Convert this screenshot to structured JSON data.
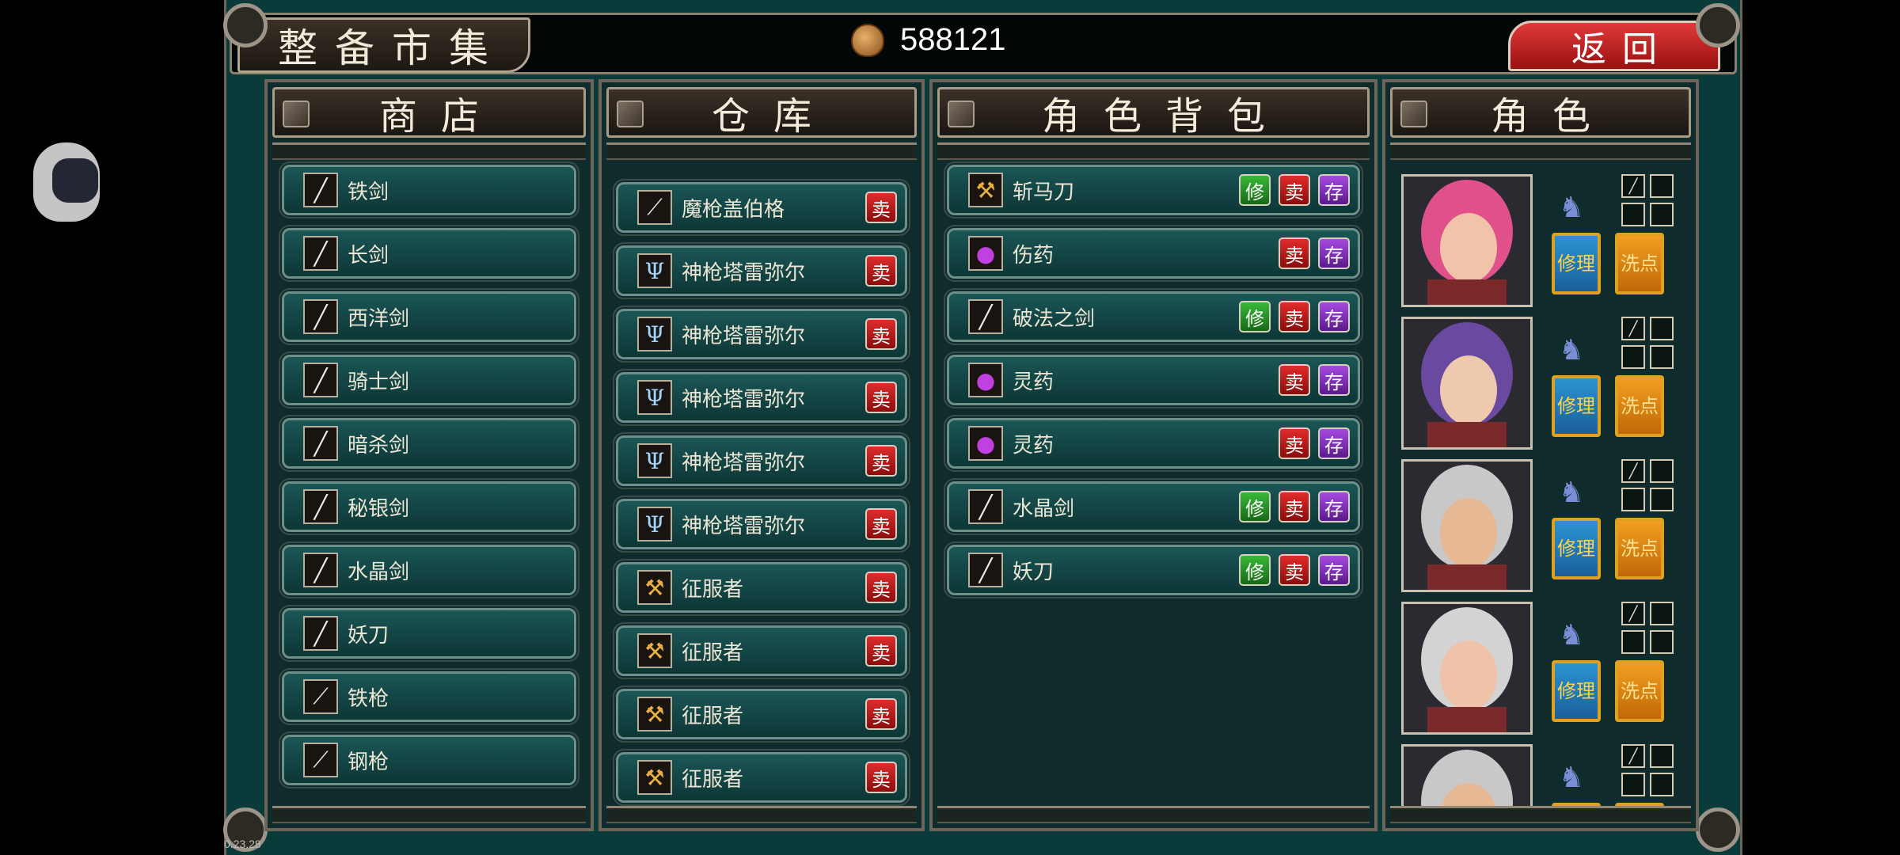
{
  "header": {
    "title": "整备市集",
    "gold": "588121",
    "back_label": "返回"
  },
  "shop": {
    "title": "商店",
    "items": [
      {
        "label": "铁剑",
        "icon": "sword-icon"
      },
      {
        "label": "长剑",
        "icon": "sword-icon"
      },
      {
        "label": "西洋剑",
        "icon": "sword-icon"
      },
      {
        "label": "骑士剑",
        "icon": "sword-icon"
      },
      {
        "label": "暗杀剑",
        "icon": "sword-icon"
      },
      {
        "label": "秘银剑",
        "icon": "sword-icon"
      },
      {
        "label": "水晶剑",
        "icon": "sword-icon"
      },
      {
        "label": "妖刀",
        "icon": "sword-icon"
      },
      {
        "label": "铁枪",
        "icon": "spear-icon"
      },
      {
        "label": "钢枪",
        "icon": "spear-icon"
      }
    ]
  },
  "warehouse": {
    "title": "仓库",
    "sell_label": "卖",
    "items": [
      {
        "label": "魔枪盖伯格",
        "icon": "spear-icon"
      },
      {
        "label": "神枪塔雷弥尔",
        "icon": "trident-icon"
      },
      {
        "label": "神枪塔雷弥尔",
        "icon": "trident-icon"
      },
      {
        "label": "神枪塔雷弥尔",
        "icon": "trident-icon"
      },
      {
        "label": "神枪塔雷弥尔",
        "icon": "trident-icon"
      },
      {
        "label": "神枪塔雷弥尔",
        "icon": "trident-icon"
      },
      {
        "label": "征服者",
        "icon": "axe-icon"
      },
      {
        "label": "征服者",
        "icon": "axe-icon"
      },
      {
        "label": "征服者",
        "icon": "axe-icon"
      },
      {
        "label": "征服者",
        "icon": "axe-icon"
      }
    ]
  },
  "bag": {
    "title": "角色背包",
    "fix_label": "修",
    "sell_label": "卖",
    "store_label": "存",
    "items": [
      {
        "label": "斩马刀",
        "icon": "axe-icon",
        "repairable": true
      },
      {
        "label": "伤药",
        "icon": "potion-icon",
        "repairable": false
      },
      {
        "label": "破法之剑",
        "icon": "sword-icon",
        "repairable": true
      },
      {
        "label": "灵药",
        "icon": "potion-icon",
        "repairable": false
      },
      {
        "label": "灵药",
        "icon": "potion-icon",
        "repairable": false
      },
      {
        "label": "水晶剑",
        "icon": "sword-icon",
        "repairable": true
      },
      {
        "label": "妖刀",
        "icon": "sword-icon",
        "repairable": true
      }
    ]
  },
  "characters": {
    "title": "角色",
    "repair_label": "修理",
    "wash_label": "洗点",
    "list": [
      {
        "portrait": "pink-hair-woman",
        "hair": "#e0508a",
        "skin": "#f1c3a8"
      },
      {
        "portrait": "hooded-purple-hair-woman",
        "hair": "#6a4aa0",
        "skin": "#efc9ae"
      },
      {
        "portrait": "helmeted-man",
        "hair": "#c8c8c8",
        "skin": "#e6b894"
      },
      {
        "portrait": "helmeted-red-crest-woman",
        "hair": "#d3d3d3",
        "skin": "#f0c2aa"
      },
      {
        "portrait": "helmeted-man",
        "hair": "#c8c8c8",
        "skin": "#e6b894"
      }
    ]
  },
  "version": "0.23.28"
}
